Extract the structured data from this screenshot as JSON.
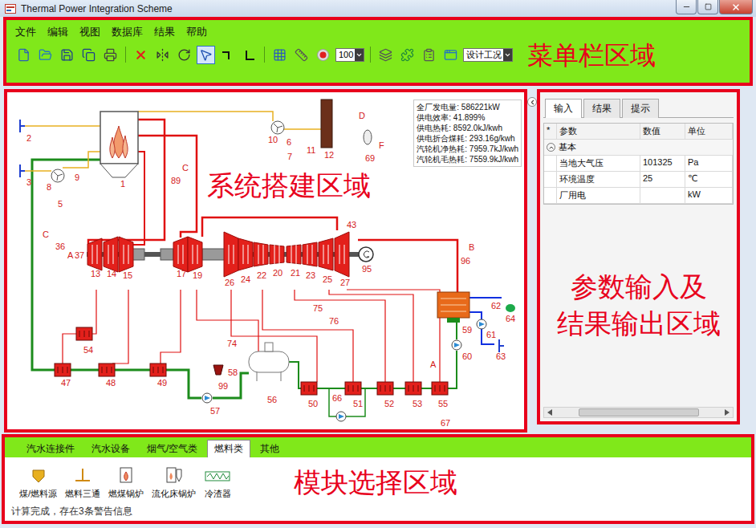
{
  "window": {
    "title": "Thermal Power Integration Scheme"
  },
  "menu": {
    "items": [
      "文件",
      "编辑",
      "视图",
      "数据库",
      "结果",
      "帮助"
    ],
    "tools": [
      {
        "kind": "new",
        "selected": false
      },
      {
        "kind": "open",
        "selected": false
      },
      {
        "kind": "save",
        "selected": false
      },
      {
        "kind": "save-all",
        "selected": false
      },
      {
        "kind": "print",
        "selected": false
      },
      {
        "kind": "separator"
      },
      {
        "kind": "delete",
        "selected": false
      },
      {
        "kind": "mirror",
        "selected": false
      },
      {
        "kind": "rotate",
        "selected": false
      },
      {
        "kind": "pointer",
        "selected": true
      },
      {
        "kind": "connect",
        "selected": false
      },
      {
        "kind": "polyline",
        "selected": false
      },
      {
        "kind": "separator"
      },
      {
        "kind": "grid",
        "selected": false
      },
      {
        "kind": "ruler",
        "selected": false
      },
      {
        "kind": "record",
        "selected": false
      },
      {
        "kind": "dropdown",
        "value": "100"
      },
      {
        "kind": "separator"
      },
      {
        "kind": "stack",
        "selected": false
      },
      {
        "kind": "plugin",
        "selected": false
      },
      {
        "kind": "report",
        "selected": false
      },
      {
        "kind": "layout",
        "selected": false
      },
      {
        "kind": "dropdown",
        "value": "设计工况"
      }
    ],
    "annotation": "菜单栏区域"
  },
  "canvas": {
    "annotation": "系统搭建区域",
    "results": [
      "全厂发电量: 586221kW",
      "供电效率: 41.899%",
      "供电热耗: 8592.0kJ/kwh",
      "供电折合煤耗: 293.16g/kwh",
      "汽轮机净热耗: 7959.7kJ/kwh",
      "汽轮机毛热耗: 7559.9kJ/kwh"
    ],
    "nodes": [
      {
        "label": "1",
        "kind": "boiler"
      },
      {
        "label": "2",
        "kind": "source"
      },
      {
        "label": "3",
        "kind": "source"
      },
      {
        "label": "8",
        "kind": "fan"
      },
      {
        "label": "9",
        "kind": "label"
      },
      {
        "label": "5",
        "kind": "label"
      },
      {
        "label": "89",
        "kind": "label"
      },
      {
        "label": "C",
        "kind": "port"
      },
      {
        "label": "10",
        "kind": "fan"
      },
      {
        "label": "6",
        "kind": "label"
      },
      {
        "label": "7",
        "kind": "label"
      },
      {
        "label": "11",
        "kind": "label"
      },
      {
        "label": "12",
        "kind": "chimney"
      },
      {
        "label": "D",
        "kind": "port"
      },
      {
        "label": "69",
        "kind": "tank"
      },
      {
        "label": "F",
        "kind": "port"
      },
      {
        "label": "C",
        "kind": "port"
      },
      {
        "label": "36",
        "kind": "label"
      },
      {
        "label": "A",
        "kind": "port"
      },
      {
        "label": "37",
        "kind": "label"
      },
      {
        "label": "13",
        "kind": "turbine"
      },
      {
        "label": "14",
        "kind": "turbine"
      },
      {
        "label": "15",
        "kind": "turbine"
      },
      {
        "label": "17",
        "kind": "turbine"
      },
      {
        "label": "19",
        "kind": "turbine"
      },
      {
        "label": "26",
        "kind": "turbine"
      },
      {
        "label": "24",
        "kind": "turbine"
      },
      {
        "label": "22",
        "kind": "turbine"
      },
      {
        "label": "20",
        "kind": "turbine"
      },
      {
        "label": "21",
        "kind": "turbine"
      },
      {
        "label": "23",
        "kind": "turbine"
      },
      {
        "label": "25",
        "kind": "turbine"
      },
      {
        "label": "27",
        "kind": "turbine"
      },
      {
        "label": "43",
        "kind": "label"
      },
      {
        "label": "95",
        "kind": "generator"
      },
      {
        "label": "B",
        "kind": "port"
      },
      {
        "label": "96",
        "kind": "label"
      },
      {
        "kind": "condenser"
      },
      {
        "label": "62",
        "kind": "label"
      },
      {
        "label": "64",
        "kind": "flag"
      },
      {
        "label": "59",
        "kind": "label"
      },
      {
        "label": "61",
        "kind": "pump"
      },
      {
        "label": "63",
        "kind": "source"
      },
      {
        "label": "60",
        "kind": "pump"
      },
      {
        "label": "75",
        "kind": "label"
      },
      {
        "label": "76",
        "kind": "label"
      },
      {
        "label": "54",
        "kind": "heater"
      },
      {
        "label": "47",
        "kind": "heater"
      },
      {
        "label": "48",
        "kind": "heater"
      },
      {
        "label": "49",
        "kind": "heater"
      },
      {
        "label": "74",
        "kind": "label"
      },
      {
        "label": "99",
        "kind": "valve"
      },
      {
        "label": "58",
        "kind": "label"
      },
      {
        "label": "56",
        "kind": "deaerator"
      },
      {
        "label": "57",
        "kind": "pump"
      },
      {
        "label": "50",
        "kind": "heater"
      },
      {
        "label": "66",
        "kind": "label"
      },
      {
        "kind": "pump"
      },
      {
        "label": "51",
        "kind": "heater"
      },
      {
        "label": "52",
        "kind": "heater"
      },
      {
        "label": "53",
        "kind": "heater"
      },
      {
        "label": "55",
        "kind": "heater"
      },
      {
        "label": "A",
        "kind": "port"
      },
      {
        "label": "67",
        "kind": "label"
      }
    ]
  },
  "panel": {
    "tabs": [
      {
        "label": "输入",
        "selected": true
      },
      {
        "label": "结果",
        "selected": false
      },
      {
        "label": "提示",
        "selected": false
      }
    ],
    "columns": [
      "*",
      "参数",
      "数值",
      "单位"
    ],
    "group": {
      "label": "基本",
      "expanded": true
    },
    "rows": [
      {
        "name": "当地大气压",
        "value": "101325",
        "unit": "Pa"
      },
      {
        "name": "环境温度",
        "value": "25",
        "unit": "℃"
      },
      {
        "name": "厂用电",
        "value": "",
        "unit": "kW"
      }
    ],
    "annotation": [
      "参数输入及",
      "结果输出区域"
    ]
  },
  "modules": {
    "tabs": [
      {
        "label": "汽水连接件",
        "selected": false
      },
      {
        "label": "汽水设备",
        "selected": false
      },
      {
        "label": "烟气/空气类",
        "selected": false
      },
      {
        "label": "燃料类",
        "selected": true
      },
      {
        "label": "其他",
        "selected": false
      }
    ],
    "items": [
      {
        "label": "煤/燃料源",
        "kind": "fuel-source"
      },
      {
        "label": "燃料三通",
        "kind": "fuel-tee"
      },
      {
        "label": "燃煤锅炉",
        "kind": "coal-boiler"
      },
      {
        "label": "流化床锅炉",
        "kind": "cfb-boiler"
      },
      {
        "label": "冷渣器",
        "kind": "slag-cooler"
      }
    ],
    "annotation": "模块选择区域"
  },
  "status_bar": "计算完成，存在3条警告信息"
}
